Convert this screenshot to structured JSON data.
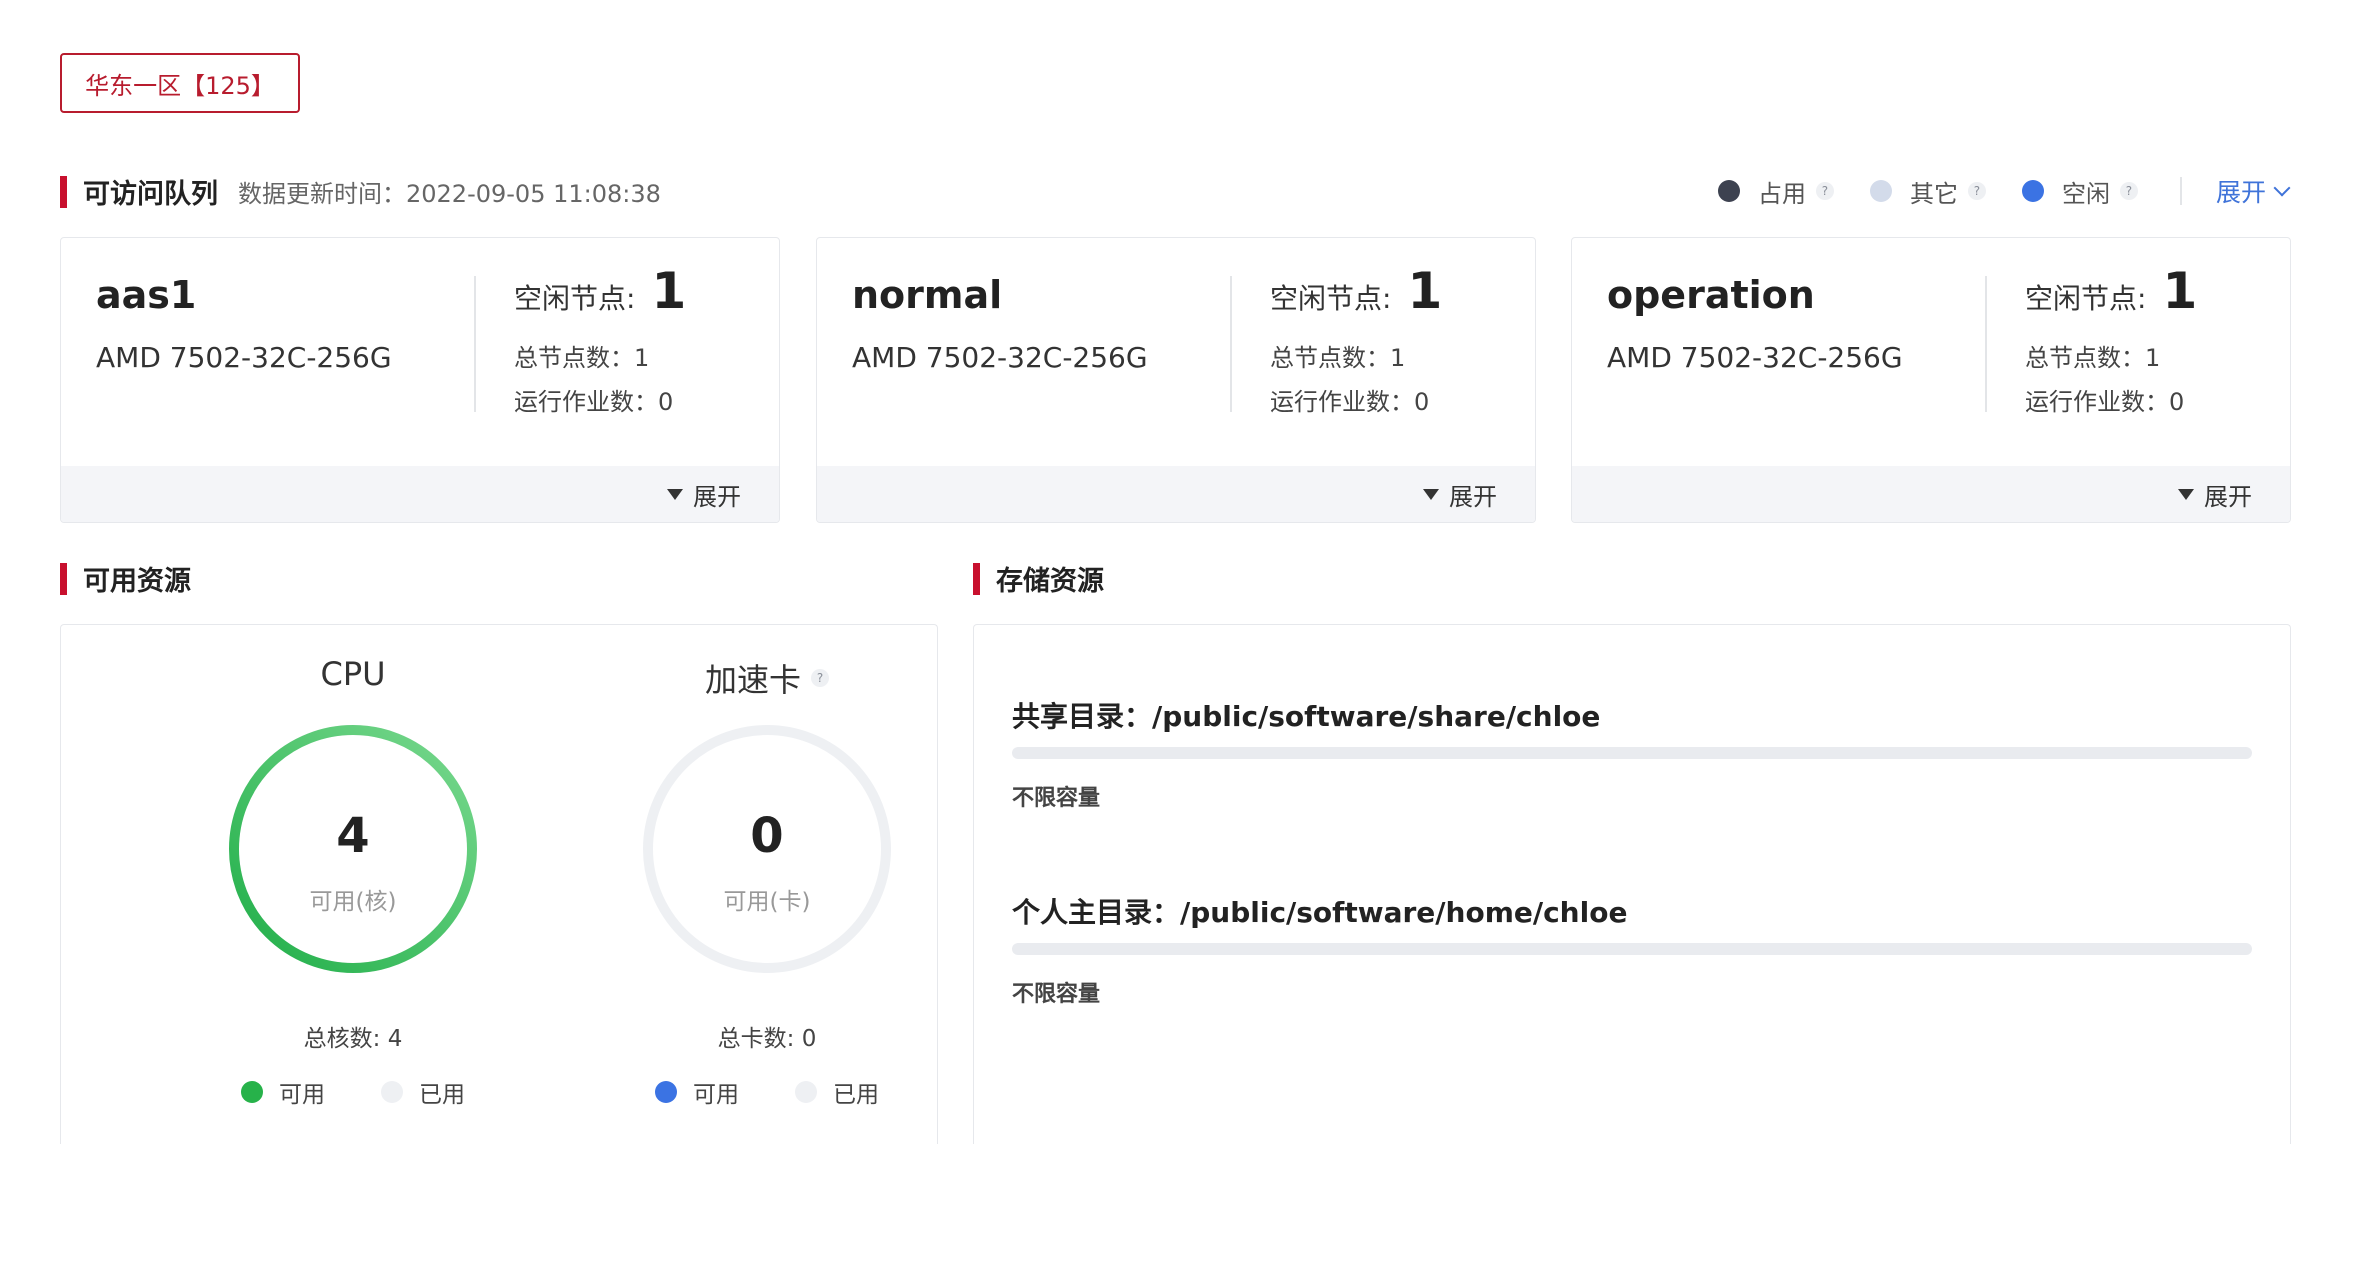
{
  "region": {
    "label": "华东一区【125】"
  },
  "queue_section": {
    "title": "可访问队列",
    "update_time": "数据更新时间：2022-09-05 11:08:38",
    "legend": [
      {
        "label": "占用",
        "color": "#3d4250"
      },
      {
        "label": "其它",
        "color": "#d3dbea"
      },
      {
        "label": "空闲",
        "color": "#3b73e3"
      }
    ],
    "expand_label": "展开"
  },
  "queues": [
    {
      "name": "aas1",
      "model": "AMD 7502-32C-256G",
      "idle_label": "空闲节点:",
      "idle_nodes": "1",
      "total_nodes": "总节点数：1",
      "running_jobs": "运行作业数：0",
      "expand_label": "展开"
    },
    {
      "name": "normal",
      "model": "AMD 7502-32C-256G",
      "idle_label": "空闲节点:",
      "idle_nodes": "1",
      "total_nodes": "总节点数：1",
      "running_jobs": "运行作业数：0",
      "expand_label": "展开"
    },
    {
      "name": "operation",
      "model": "AMD 7502-32C-256G",
      "idle_label": "空闲节点:",
      "idle_nodes": "1",
      "total_nodes": "总节点数：1",
      "running_jobs": "运行作业数：0",
      "expand_label": "展开"
    }
  ],
  "resources": {
    "title": "可用资源",
    "cpu": {
      "title": "CPU",
      "value": "4",
      "unit": "可用(核)",
      "total": "总核数: 4",
      "available_fraction": 1.0,
      "color_available": "#27b24a",
      "color_used": "#ebedf0",
      "legend": [
        "可用",
        "已用"
      ]
    },
    "accel": {
      "title": "加速卡",
      "value": "0",
      "unit": "可用(卡)",
      "total": "总卡数: 0",
      "available_fraction": 0,
      "color_available": "#3b73e3",
      "color_used": "#ebedf0",
      "legend": [
        "可用",
        "已用"
      ]
    }
  },
  "storage": {
    "title": "存储资源",
    "items": [
      {
        "label": "共享目录：/public/software/share/chloe",
        "capacity": "不限容量"
      },
      {
        "label": "个人主目录：/public/software/home/chloe",
        "capacity": "不限容量"
      }
    ]
  }
}
